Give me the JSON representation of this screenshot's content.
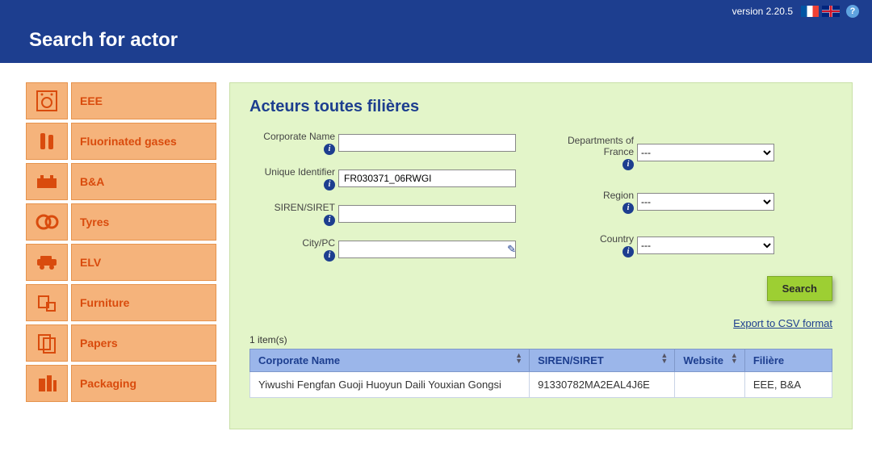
{
  "topbar": {
    "version": "version 2.20.5"
  },
  "header": {
    "title": "Search for actor"
  },
  "sidebar": {
    "items": [
      {
        "label": "EEE"
      },
      {
        "label": "Fluorinated gases"
      },
      {
        "label": "B&A"
      },
      {
        "label": "Tyres"
      },
      {
        "label": "ELV"
      },
      {
        "label": "Furniture"
      },
      {
        "label": "Papers"
      },
      {
        "label": "Packaging"
      }
    ]
  },
  "panel": {
    "title": "Acteurs toutes filières",
    "labels": {
      "corporate_name": "Corporate Name",
      "unique_identifier": "Unique Identifier",
      "siren_siret": "SIREN/SIRET",
      "city_pc": "City/PC",
      "departments": "Departments of France",
      "region": "Region",
      "country": "Country"
    },
    "values": {
      "corporate_name": "",
      "unique_identifier": "FR030371_06RWGI",
      "siren_siret": "",
      "city_pc": "",
      "departments": "---",
      "region": "---",
      "country": "---"
    },
    "select_blank": "---",
    "search_button": "Search",
    "export_link": "Export to CSV format",
    "result_count": "1 item(s)",
    "columns": {
      "corporate_name": "Corporate Name",
      "siren_siret": "SIREN/SIRET",
      "website": "Website",
      "filiere": "Filière"
    },
    "rows": [
      {
        "corporate_name": "Yiwushi Fengfan Guoji Huoyun Daili Youxian Gongsi",
        "siren_siret": "91330782MA2EAL4J6E",
        "website": "",
        "filiere": "EEE, B&A"
      }
    ]
  }
}
